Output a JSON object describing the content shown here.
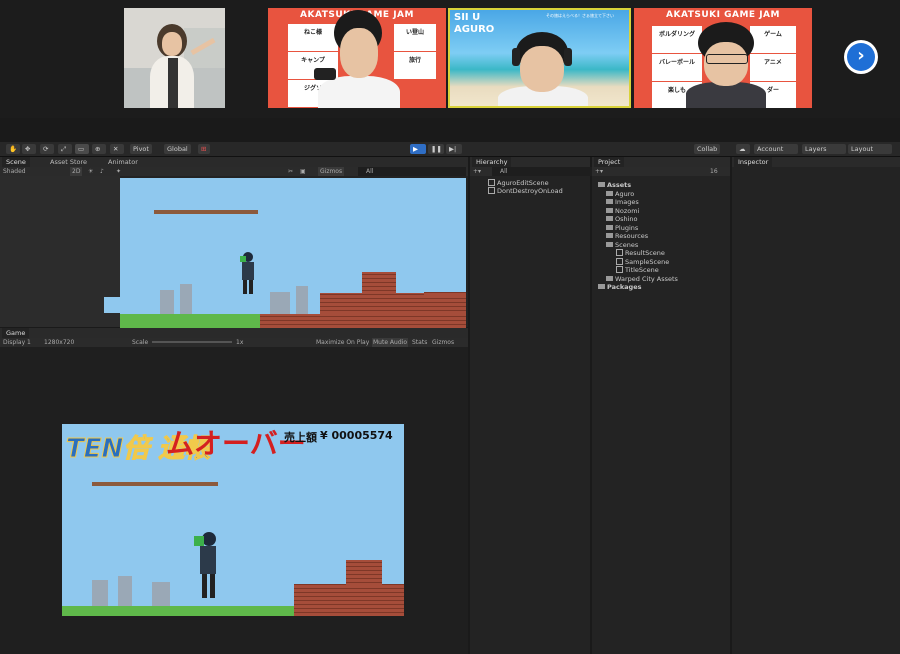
{
  "video": {
    "tiles": [
      {
        "name": "participant-photo"
      },
      {
        "poster_title": "AKATSUKI GAME JAM",
        "cards": [
          "ねこ様",
          "い登山",
          "キャンプ",
          "旅行",
          "ジグソ"
        ]
      },
      {
        "label_line1": "SII U",
        "label_line2": "AGURO",
        "caption": "その旅はえらべる！さぁ旅立て下さい"
      },
      {
        "poster_title": "AKATSUKI GAME JAM",
        "cards": [
          "ボルダリング",
          "ゲーム",
          "バレーボール",
          "アニメ",
          "楽しも",
          "ダー"
        ]
      }
    ],
    "next_icon": "chevron-right-icon"
  },
  "toolbar": {
    "pivot": "Pivot",
    "global": "Global",
    "collab": "Collab",
    "account": "Account",
    "layers": "Layers",
    "layout": "Layout"
  },
  "scene": {
    "tabs": [
      "Scene",
      "Asset Store",
      "Animator"
    ],
    "shading": "Shaded",
    "mode2d": "2D",
    "gizmos": "Gizmos",
    "search": "All"
  },
  "game": {
    "tab": "Game",
    "display": "Display 1",
    "resolution": "1280x720",
    "scale_label": "Scale",
    "scale_value": "1x",
    "maximize": "Maximize On Play",
    "mute": "Mute Audio",
    "stats": "Stats",
    "gizmos": "Gizmos",
    "overlay_text": "ムオーバー",
    "sales_label": "売上額",
    "sales_value": "¥ 00005574",
    "logo": "TEN倍 通帳"
  },
  "hierarchy": {
    "tab": "Hierarchy",
    "search": "All",
    "items": [
      "AguroEditScene",
      "DontDestroyOnLoad"
    ]
  },
  "project": {
    "tab": "Project",
    "count": "16",
    "assets_label": "Assets",
    "folders": [
      "Aguro",
      "Images",
      "Nozomi",
      "Oshino",
      "Plugins",
      "Resources"
    ],
    "scenes_label": "Scenes",
    "scenes": [
      "ResultScene",
      "SampleScene",
      "TitleScene"
    ],
    "other": "Warped City Assets",
    "packages": "Packages"
  },
  "inspector": {
    "tab": "Inspector"
  },
  "colors": {
    "accent": "#1f6fd6",
    "poster": "#e8543f",
    "overlay_red": "#d42020"
  }
}
